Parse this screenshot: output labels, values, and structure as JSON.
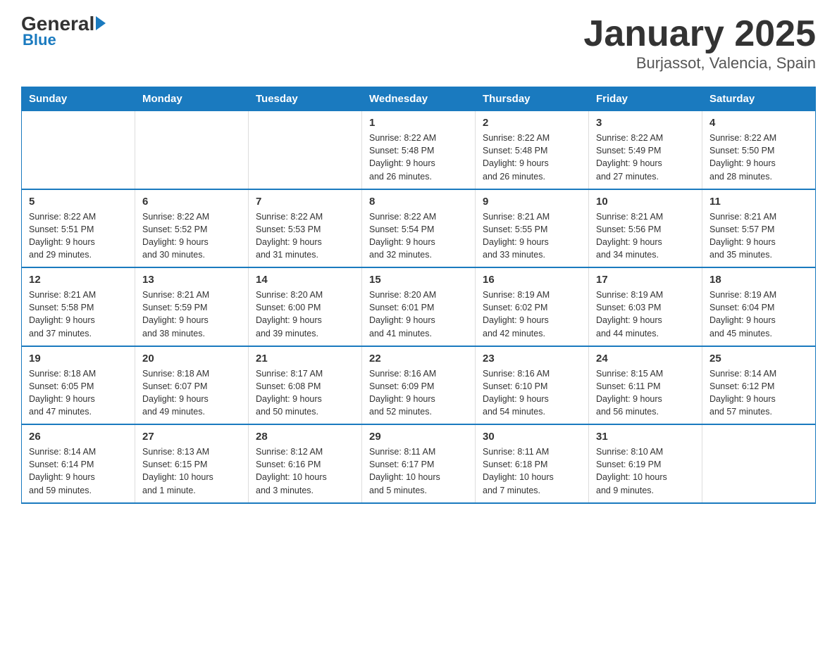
{
  "header": {
    "logo_general": "General",
    "logo_blue": "Blue",
    "title": "January 2025",
    "subtitle": "Burjassot, Valencia, Spain"
  },
  "days_of_week": [
    "Sunday",
    "Monday",
    "Tuesday",
    "Wednesday",
    "Thursday",
    "Friday",
    "Saturday"
  ],
  "weeks": [
    [
      {
        "num": "",
        "info": ""
      },
      {
        "num": "",
        "info": ""
      },
      {
        "num": "",
        "info": ""
      },
      {
        "num": "1",
        "info": "Sunrise: 8:22 AM\nSunset: 5:48 PM\nDaylight: 9 hours\nand 26 minutes."
      },
      {
        "num": "2",
        "info": "Sunrise: 8:22 AM\nSunset: 5:48 PM\nDaylight: 9 hours\nand 26 minutes."
      },
      {
        "num": "3",
        "info": "Sunrise: 8:22 AM\nSunset: 5:49 PM\nDaylight: 9 hours\nand 27 minutes."
      },
      {
        "num": "4",
        "info": "Sunrise: 8:22 AM\nSunset: 5:50 PM\nDaylight: 9 hours\nand 28 minutes."
      }
    ],
    [
      {
        "num": "5",
        "info": "Sunrise: 8:22 AM\nSunset: 5:51 PM\nDaylight: 9 hours\nand 29 minutes."
      },
      {
        "num": "6",
        "info": "Sunrise: 8:22 AM\nSunset: 5:52 PM\nDaylight: 9 hours\nand 30 minutes."
      },
      {
        "num": "7",
        "info": "Sunrise: 8:22 AM\nSunset: 5:53 PM\nDaylight: 9 hours\nand 31 minutes."
      },
      {
        "num": "8",
        "info": "Sunrise: 8:22 AM\nSunset: 5:54 PM\nDaylight: 9 hours\nand 32 minutes."
      },
      {
        "num": "9",
        "info": "Sunrise: 8:21 AM\nSunset: 5:55 PM\nDaylight: 9 hours\nand 33 minutes."
      },
      {
        "num": "10",
        "info": "Sunrise: 8:21 AM\nSunset: 5:56 PM\nDaylight: 9 hours\nand 34 minutes."
      },
      {
        "num": "11",
        "info": "Sunrise: 8:21 AM\nSunset: 5:57 PM\nDaylight: 9 hours\nand 35 minutes."
      }
    ],
    [
      {
        "num": "12",
        "info": "Sunrise: 8:21 AM\nSunset: 5:58 PM\nDaylight: 9 hours\nand 37 minutes."
      },
      {
        "num": "13",
        "info": "Sunrise: 8:21 AM\nSunset: 5:59 PM\nDaylight: 9 hours\nand 38 minutes."
      },
      {
        "num": "14",
        "info": "Sunrise: 8:20 AM\nSunset: 6:00 PM\nDaylight: 9 hours\nand 39 minutes."
      },
      {
        "num": "15",
        "info": "Sunrise: 8:20 AM\nSunset: 6:01 PM\nDaylight: 9 hours\nand 41 minutes."
      },
      {
        "num": "16",
        "info": "Sunrise: 8:19 AM\nSunset: 6:02 PM\nDaylight: 9 hours\nand 42 minutes."
      },
      {
        "num": "17",
        "info": "Sunrise: 8:19 AM\nSunset: 6:03 PM\nDaylight: 9 hours\nand 44 minutes."
      },
      {
        "num": "18",
        "info": "Sunrise: 8:19 AM\nSunset: 6:04 PM\nDaylight: 9 hours\nand 45 minutes."
      }
    ],
    [
      {
        "num": "19",
        "info": "Sunrise: 8:18 AM\nSunset: 6:05 PM\nDaylight: 9 hours\nand 47 minutes."
      },
      {
        "num": "20",
        "info": "Sunrise: 8:18 AM\nSunset: 6:07 PM\nDaylight: 9 hours\nand 49 minutes."
      },
      {
        "num": "21",
        "info": "Sunrise: 8:17 AM\nSunset: 6:08 PM\nDaylight: 9 hours\nand 50 minutes."
      },
      {
        "num": "22",
        "info": "Sunrise: 8:16 AM\nSunset: 6:09 PM\nDaylight: 9 hours\nand 52 minutes."
      },
      {
        "num": "23",
        "info": "Sunrise: 8:16 AM\nSunset: 6:10 PM\nDaylight: 9 hours\nand 54 minutes."
      },
      {
        "num": "24",
        "info": "Sunrise: 8:15 AM\nSunset: 6:11 PM\nDaylight: 9 hours\nand 56 minutes."
      },
      {
        "num": "25",
        "info": "Sunrise: 8:14 AM\nSunset: 6:12 PM\nDaylight: 9 hours\nand 57 minutes."
      }
    ],
    [
      {
        "num": "26",
        "info": "Sunrise: 8:14 AM\nSunset: 6:14 PM\nDaylight: 9 hours\nand 59 minutes."
      },
      {
        "num": "27",
        "info": "Sunrise: 8:13 AM\nSunset: 6:15 PM\nDaylight: 10 hours\nand 1 minute."
      },
      {
        "num": "28",
        "info": "Sunrise: 8:12 AM\nSunset: 6:16 PM\nDaylight: 10 hours\nand 3 minutes."
      },
      {
        "num": "29",
        "info": "Sunrise: 8:11 AM\nSunset: 6:17 PM\nDaylight: 10 hours\nand 5 minutes."
      },
      {
        "num": "30",
        "info": "Sunrise: 8:11 AM\nSunset: 6:18 PM\nDaylight: 10 hours\nand 7 minutes."
      },
      {
        "num": "31",
        "info": "Sunrise: 8:10 AM\nSunset: 6:19 PM\nDaylight: 10 hours\nand 9 minutes."
      },
      {
        "num": "",
        "info": ""
      }
    ]
  ]
}
